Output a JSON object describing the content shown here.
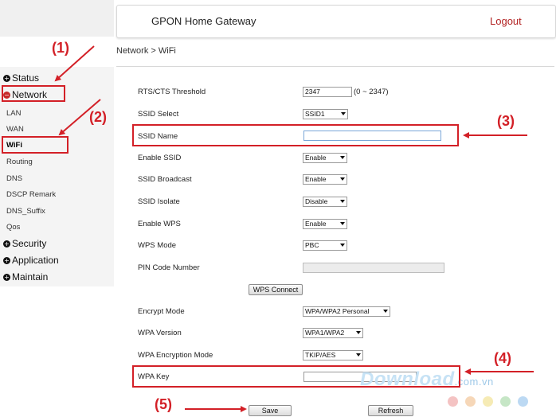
{
  "header": {
    "title": "GPON Home Gateway",
    "logout_label": "Logout"
  },
  "breadcrumb": "Network > WiFi",
  "sidebar": {
    "sections": [
      {
        "label": "Status",
        "marker": "+"
      },
      {
        "label": "Network",
        "marker": "−"
      },
      {
        "label": "Security",
        "marker": "+"
      },
      {
        "label": "Application",
        "marker": "+"
      },
      {
        "label": "Maintain",
        "marker": "+"
      }
    ],
    "network_items": [
      "LAN",
      "WAN",
      "WiFi",
      "Routing",
      "DNS",
      "DSCP Remark",
      "DNS_Suffix",
      "Qos"
    ]
  },
  "form": {
    "rts_label": "RTS/CTS Threshold",
    "rts_value": "2347",
    "rts_range": "(0 ~ 2347)",
    "ssid_select_label": "SSID Select",
    "ssid_select_value": "SSID1",
    "ssid_name_label": "SSID Name",
    "ssid_name_value": "",
    "enable_ssid_label": "Enable SSID",
    "enable_ssid_value": "Enable",
    "ssid_broadcast_label": "SSID Broadcast",
    "ssid_broadcast_value": "Enable",
    "ssid_isolate_label": "SSID Isolate",
    "ssid_isolate_value": "Disable",
    "enable_wps_label": "Enable WPS",
    "enable_wps_value": "Enable",
    "wps_mode_label": "WPS Mode",
    "wps_mode_value": "PBC",
    "pin_label": "PIN Code Number",
    "pin_value": "",
    "wps_connect_label": "WPS Connect",
    "encrypt_mode_label": "Encrypt Mode",
    "encrypt_mode_value": "WPA/WPA2 Personal",
    "wpa_version_label": "WPA Version",
    "wpa_version_value": "WPA1/WPA2",
    "wpa_enc_label": "WPA Encryption Mode",
    "wpa_enc_value": "TKIP/AES",
    "wpa_key_label": "WPA Key",
    "wpa_key_value": "",
    "save_label": "Save",
    "refresh_label": "Refresh"
  },
  "annotations": {
    "n1": "(1)",
    "n2": "(2)",
    "n3": "(3)",
    "n4": "(4)",
    "n5": "(5)",
    "color": "#d32027"
  },
  "watermark": {
    "text": "Download",
    "suffix": ".com.vn",
    "dot_colors": [
      "#e53935",
      "#fb8c00",
      "#fdd835",
      "#43a047",
      "#1e88e5"
    ]
  }
}
